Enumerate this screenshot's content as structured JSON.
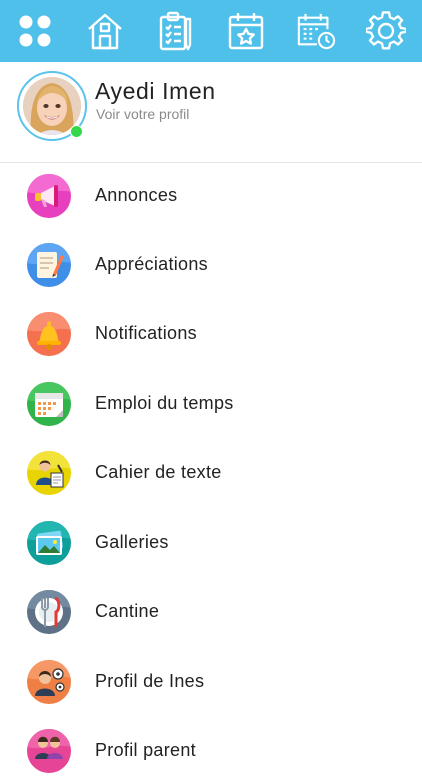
{
  "topbar": {
    "icons": [
      "grid-icon",
      "home-icon",
      "clipboard-checklist-icon",
      "calendar-star-icon",
      "calendar-clock-icon",
      "gear-icon"
    ]
  },
  "profile": {
    "name": "Ayedi Imen",
    "subtitle": "Voir votre profil",
    "status_color": "#33d94a"
  },
  "menu": {
    "items": [
      {
        "label": "Annonces",
        "icon": "megaphone-icon"
      },
      {
        "label": "Appréciations",
        "icon": "notepad-pencil-icon"
      },
      {
        "label": "Notifications",
        "icon": "bell-icon"
      },
      {
        "label": "Emploi du temps",
        "icon": "calendar-icon"
      },
      {
        "label": "Cahier de texte",
        "icon": "teacher-icon"
      },
      {
        "label": "Galleries",
        "icon": "photo-gallery-icon"
      },
      {
        "label": "Cantine",
        "icon": "fork-knife-icon"
      },
      {
        "label": "Profil de Ines",
        "icon": "child-settings-icon"
      },
      {
        "label": "Profil parent",
        "icon": "parent-icon"
      }
    ]
  },
  "colors": {
    "topbar": "#4fc0ea",
    "text": "#222222",
    "subtext": "#8b8b8b"
  }
}
